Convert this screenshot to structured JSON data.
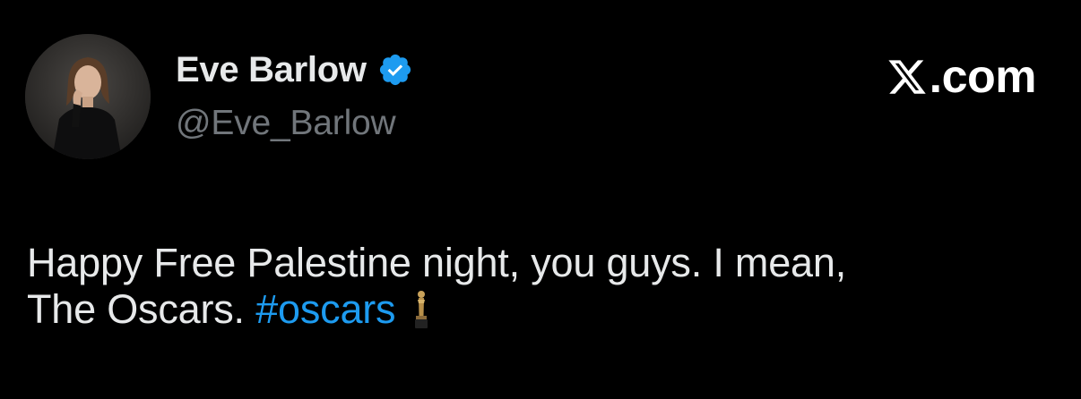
{
  "author": {
    "display_name": "Eve Barlow",
    "handle": "@Eve_Barlow",
    "verified": true,
    "verified_icon": "verified-badge-icon",
    "avatar_icon": "profile-photo"
  },
  "brand": {
    "logo_icon": "x-logo-icon",
    "domain": ".com"
  },
  "tweet": {
    "line1": "Happy Free Palestine night, you guys. I mean,",
    "line2_text": "The Oscars.",
    "hashtag": "#oscars",
    "emoji_icon": "oscar-statuette-icon"
  },
  "colors": {
    "background": "#000000",
    "text": "#e7e9ea",
    "muted": "#71767b",
    "accent": "#1d9bf0"
  }
}
